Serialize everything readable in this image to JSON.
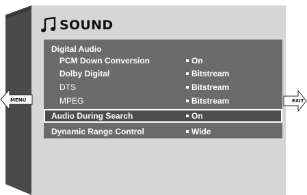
{
  "screen_title": "SOUND",
  "icons": {
    "title": "music-note-icon"
  },
  "nav": {
    "left_label": "MENU",
    "right_label": "EXIT"
  },
  "menu": {
    "group_heading": "Digital Audio",
    "items": [
      {
        "label": "PCM Down Conversion",
        "value": "On"
      },
      {
        "label": "Dolby Digital",
        "value": "Bitstream"
      },
      {
        "label": "DTS",
        "value": "Bitstream"
      },
      {
        "label": "MPEG",
        "value": "Bitstream"
      }
    ],
    "selected": {
      "label": "Audio  During Search",
      "value": "On"
    },
    "last": {
      "label": "Dynamic Range Control",
      "value": "Wide"
    }
  },
  "colors": {
    "panel": "#6b6b6b",
    "screen": "#d6d6d6",
    "selected": "#4d4d4d"
  }
}
